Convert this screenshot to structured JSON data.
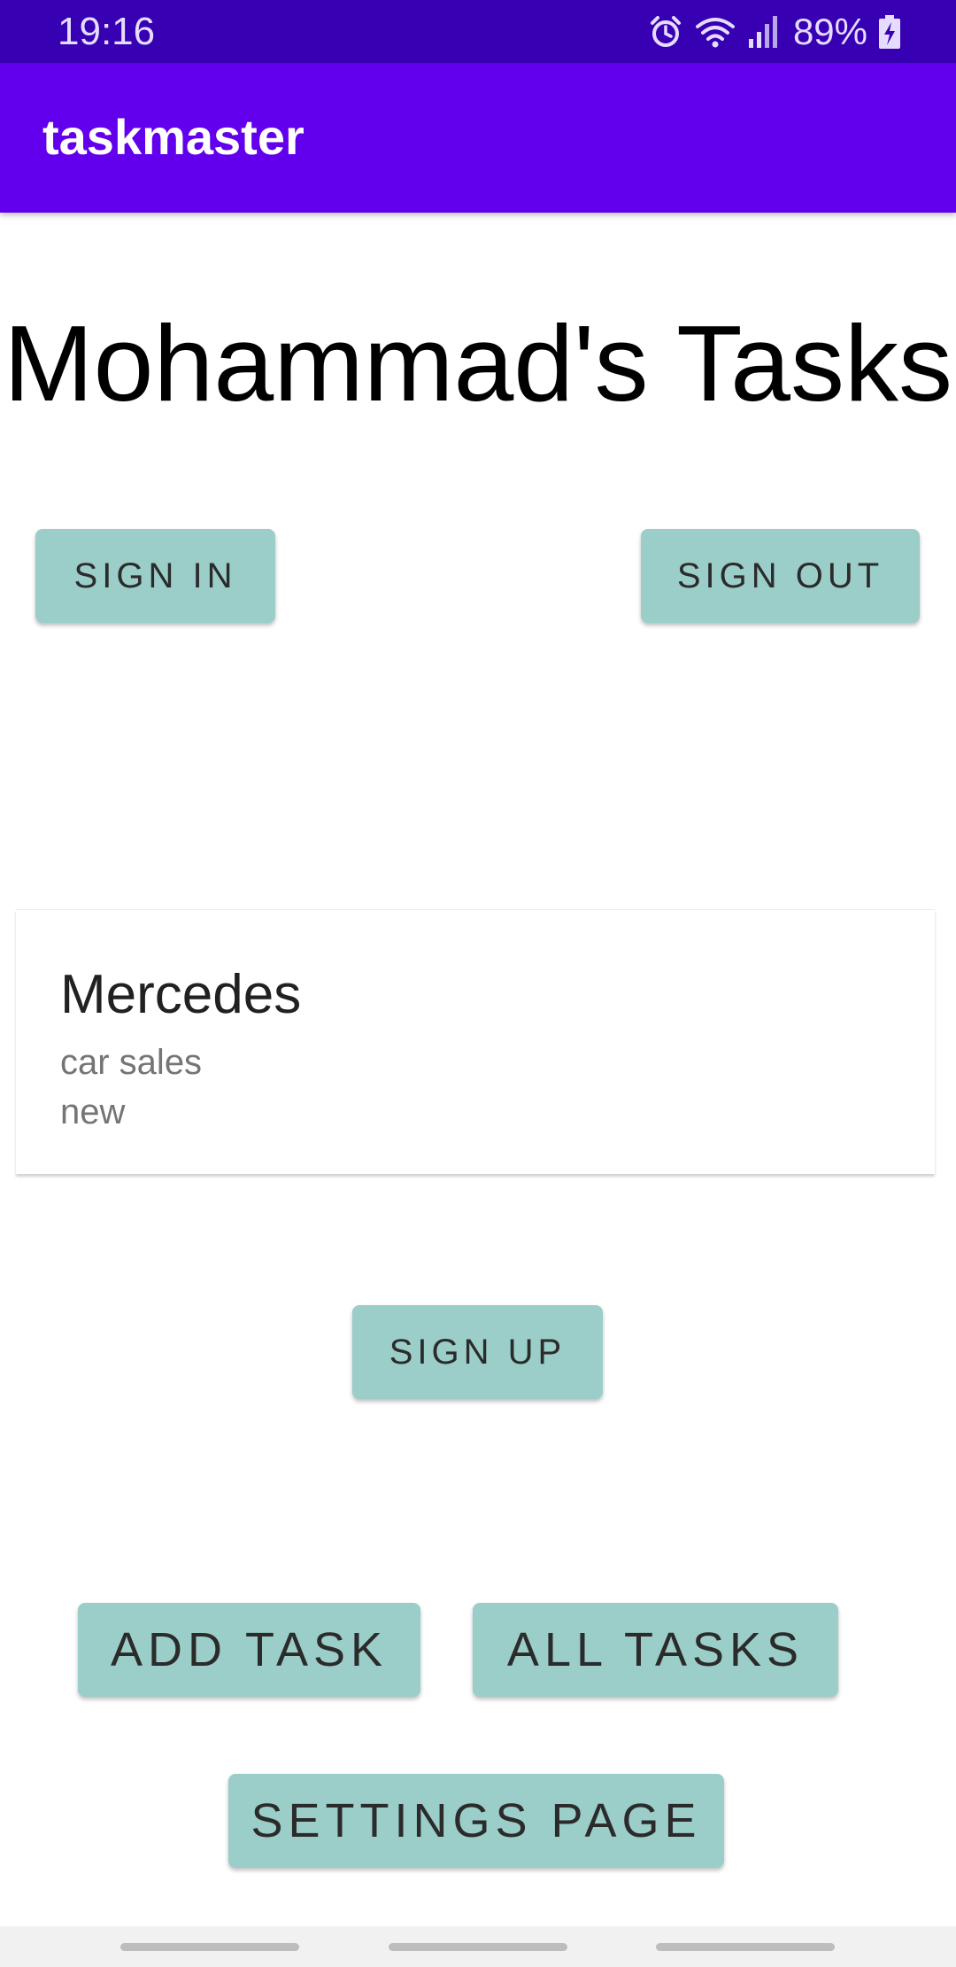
{
  "status_bar": {
    "time": "19:16",
    "battery_percent": "89%",
    "icons": [
      "alarm-icon",
      "wifi-icon",
      "signal-icon",
      "battery-charging-icon"
    ]
  },
  "app_bar": {
    "title": "taskmaster",
    "color": "#6200ee"
  },
  "page": {
    "heading": "Mohammad's Tasks"
  },
  "auth": {
    "sign_in_label": "SIGN IN",
    "sign_out_label": "SIGN OUT",
    "sign_up_label": "SIGN UP"
  },
  "tasks": [
    {
      "title": "Mercedes",
      "body": "car sales",
      "state": "new"
    }
  ],
  "actions": {
    "add_task_label": "ADD TASK",
    "all_tasks_label": "ALL TASKS",
    "settings_label": "SETTINGS PAGE"
  },
  "colors": {
    "status_bar": "#3700b3",
    "app_bar": "#6200ee",
    "button": "#9bcec8"
  }
}
